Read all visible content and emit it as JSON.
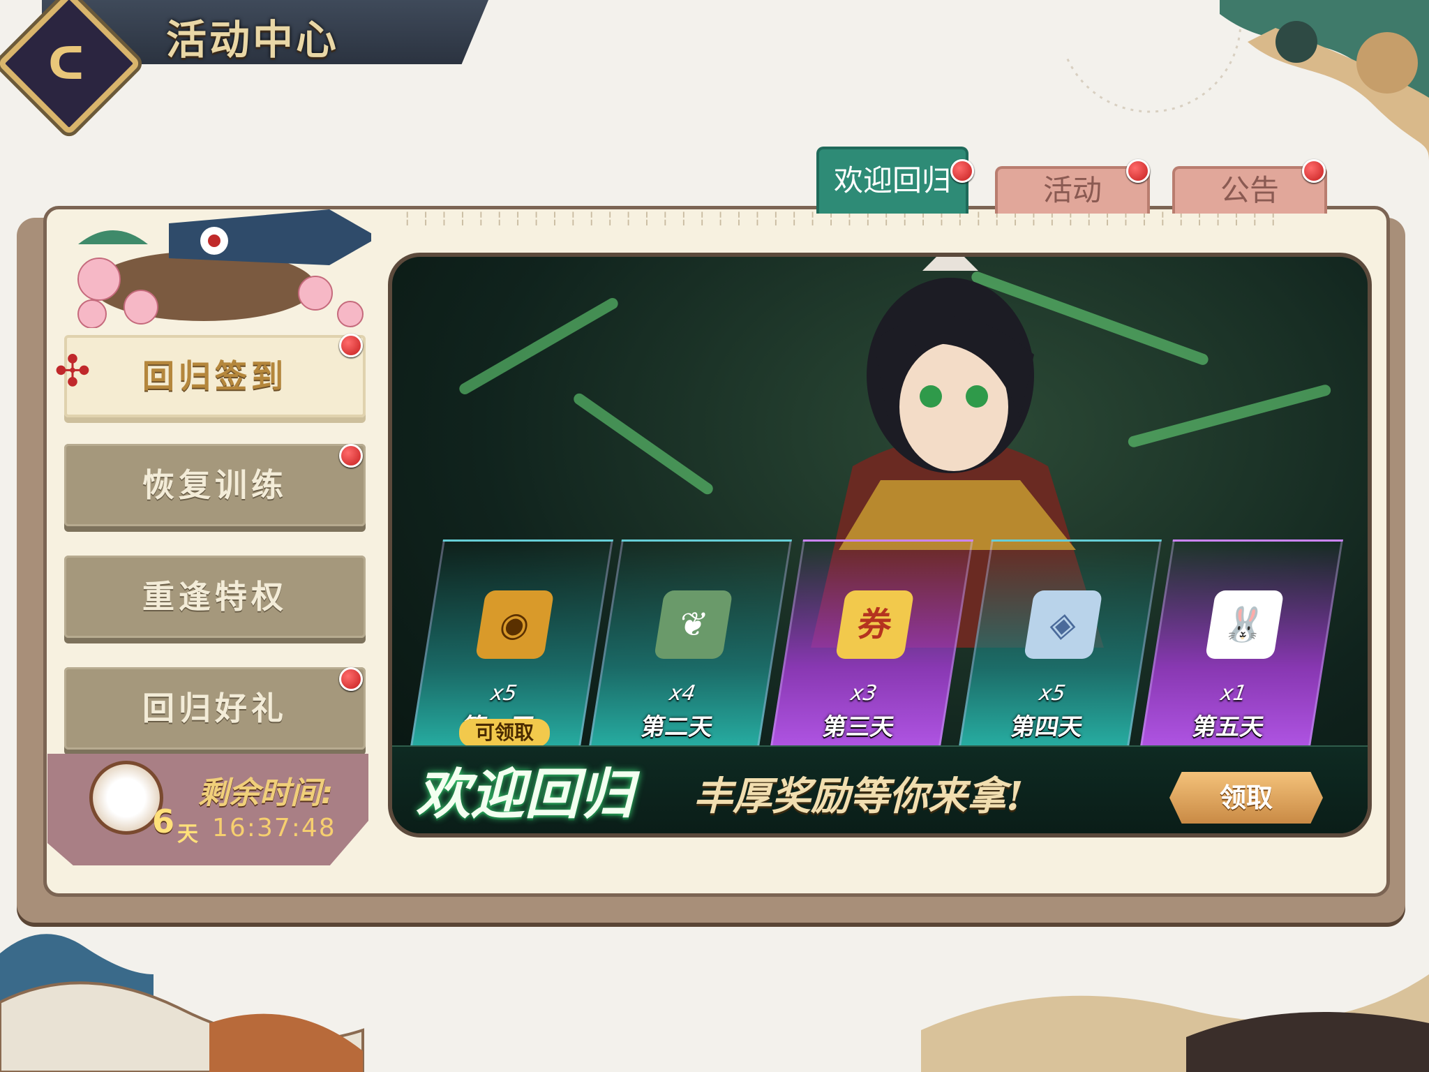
{
  "header": {
    "title": "活动中心"
  },
  "tabs": [
    {
      "label": "欢迎回归",
      "active": true,
      "badge": true
    },
    {
      "label": "活动",
      "active": false,
      "badge": true
    },
    {
      "label": "公告",
      "active": false,
      "badge": true
    }
  ],
  "menu": [
    {
      "label": "回归签到",
      "active": true,
      "badge": true
    },
    {
      "label": "恢复训练",
      "active": false,
      "badge": true
    },
    {
      "label": "重逢特权",
      "active": false,
      "badge": false
    },
    {
      "label": "回归好礼",
      "active": false,
      "badge": true
    }
  ],
  "timer": {
    "label": "剩余时间:",
    "days": "6",
    "day_unit": "天",
    "clock": "16:37:48"
  },
  "rewards": [
    {
      "qty": "x5",
      "day": "第一天",
      "status": "可领取",
      "style": "teal",
      "icon": "gold-coin-card-icon"
    },
    {
      "qty": "x4",
      "day": "第二天",
      "status": "",
      "style": "teal",
      "icon": "elder-hero-icon"
    },
    {
      "qty": "x3",
      "day": "第三天",
      "status": "",
      "style": "purple",
      "icon": "coupon-icon"
    },
    {
      "qty": "x5",
      "day": "第四天",
      "status": "",
      "style": "teal",
      "icon": "crystal-card-icon"
    },
    {
      "qty": "x1",
      "day": "第五天",
      "status": "",
      "style": "purple",
      "icon": "rabbit-hero-icon"
    }
  ],
  "reward_icon_glyphs": [
    "◉",
    "❦",
    "券",
    "◈",
    "🐰"
  ],
  "banner": {
    "welcome": "欢迎回归",
    "subtitle": "丰厚奖励等你来拿!",
    "claim_label": "领取"
  },
  "colors": {
    "active_tab": "#2e8b76",
    "inactive_tab": "#e1a79a",
    "badge": "#c51f1f",
    "menu_active_text": "#b5873c"
  }
}
